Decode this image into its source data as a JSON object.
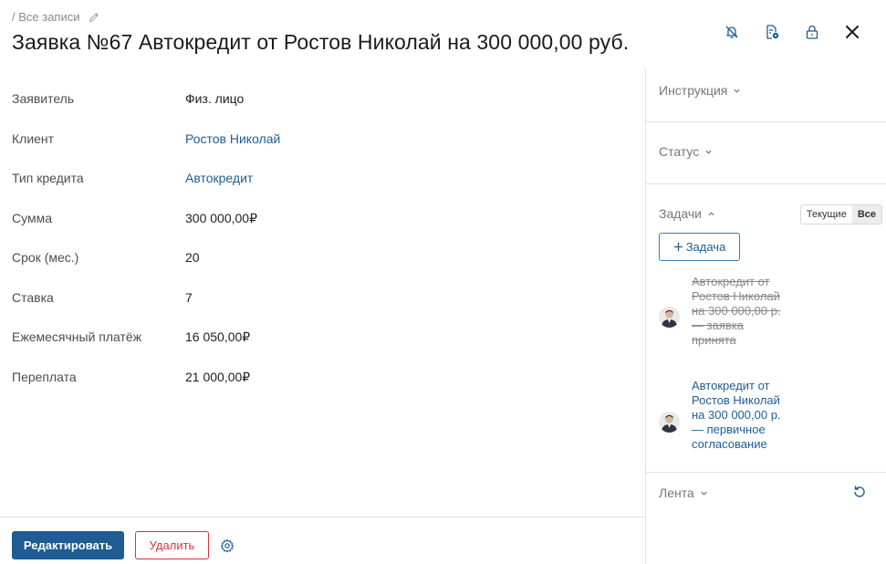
{
  "breadcrumb": {
    "text": "/ Все записи",
    "edit_icon": "pencil-icon"
  },
  "page_title": "Заявка №67 Автокредит от Ростов Николай на 300 000,00 руб.",
  "header_icons": [
    "bell-off-icon",
    "document-settings-icon",
    "lock-icon",
    "close-icon"
  ],
  "fields": [
    {
      "label": "Заявитель",
      "value": "Физ. лицо",
      "link": false
    },
    {
      "label": "Клиент",
      "value": "Ростов Николай",
      "link": true
    },
    {
      "label": "Тип кредита",
      "value": "Автокредит",
      "link": true
    },
    {
      "label": "Сумма",
      "value": "300 000,00₽",
      "link": false
    },
    {
      "label": "Срок (мес.)",
      "value": "20",
      "link": false
    },
    {
      "label": "Ставка",
      "value": "7",
      "link": false
    },
    {
      "label": "Ежемесячный платёж",
      "value": "16 050,00₽",
      "link": false
    },
    {
      "label": "Переплата",
      "value": "21 000,00₽",
      "link": false
    }
  ],
  "footer": {
    "edit_label": "Редактировать",
    "delete_label": "Удалить"
  },
  "sidebar": {
    "instruction": "Инструкция",
    "status": "Статус",
    "tasks": "Задачи",
    "tasks_filter": {
      "current": "Текущие",
      "all": "Все",
      "selected": "Все"
    },
    "add_task": "Задача",
    "task_items": [
      {
        "text": "Автокредит от Ростов Николай на 300 000,00 р. — заявка принята",
        "done": true
      },
      {
        "text": "Автокредит от Ростов Николай на 300 000,00 р. — первичное согласование",
        "done": false
      }
    ],
    "feed": "Лента"
  },
  "colors": {
    "accent": "#1e5c93",
    "link": "#1f5d94",
    "danger": "#d8353c",
    "muted": "#8a8a8a"
  }
}
